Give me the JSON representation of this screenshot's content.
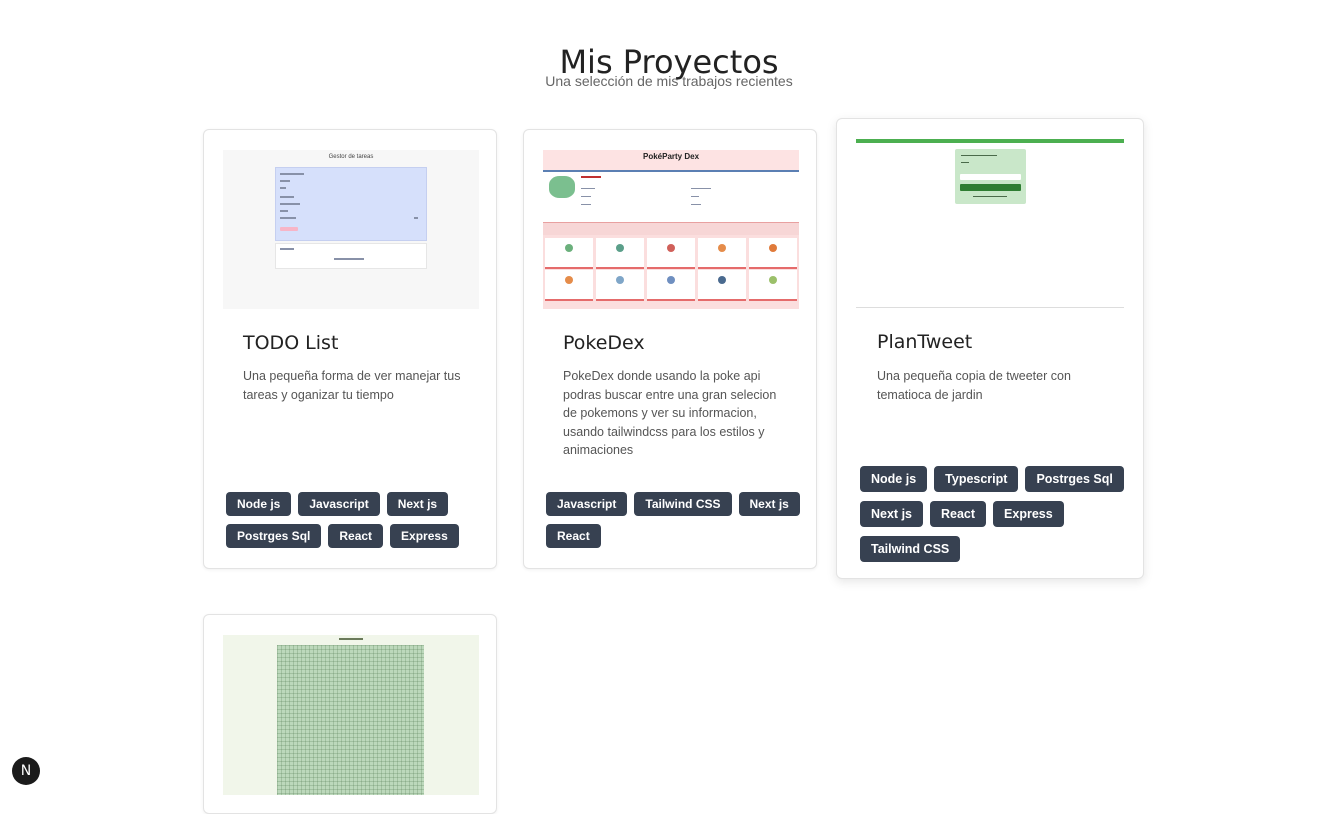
{
  "header": {
    "title": "Mis Proyectos",
    "subtitle": "Una selección de mis trabajos recientes"
  },
  "projects": [
    {
      "title": "TODO List",
      "description": "Una pequeña forma de ver manejar tus tareas y oganizar tu tiempo",
      "tags": [
        "Node js",
        "Javascript",
        "Next js",
        "Postrges Sql",
        "React",
        "Express"
      ],
      "thumb_caption": "Gestor de tareas"
    },
    {
      "title": "PokeDex",
      "description": "PokeDex donde usando la poke api podras buscar entre una gran selecion de pokemons y ver su informacion, usando tailwindcss para los estilos y animaciones",
      "tags": [
        "Javascript",
        "Tailwind CSS",
        "Next js",
        "React"
      ],
      "thumb_caption": "PokéParty Dex"
    },
    {
      "title": "PlanTweet",
      "description": "Una pequeña copia de tweeter con tematioca de jardin",
      "tags": [
        "Node js",
        "Typescript",
        "Postrges Sql",
        "Next js",
        "React",
        "Express",
        "Tailwind CSS"
      ]
    }
  ],
  "dev_badge": {
    "label": "N"
  },
  "colors": {
    "tag_bg": "#374151",
    "tag_text": "#ffffff",
    "garden_green": "#bcd8bb",
    "poke_pink": "#fde3e3"
  }
}
